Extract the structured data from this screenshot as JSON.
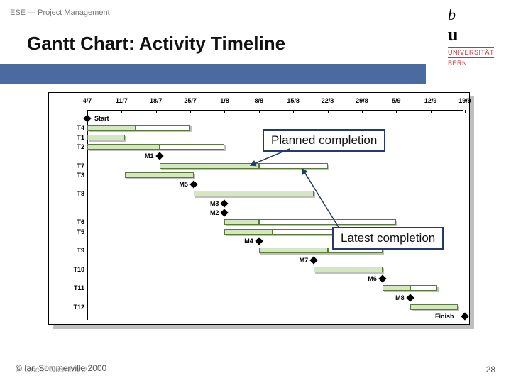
{
  "meta": {
    "breadcrumb": "ESE — Project Management",
    "title": "Gantt Chart: Activity Timeline",
    "uni_top": "b",
    "uni_mid": "u",
    "uni_line1": "UNIVERSITÄT",
    "uni_line2": "BERN",
    "footer_left": "© Ian Sommerville 2000",
    "footer_left_ghost": "© Oscar Nierstrasz",
    "page_number": "28"
  },
  "callouts": {
    "planned": "Planned completion",
    "latest": "Latest completion"
  },
  "chart_data": {
    "type": "bar",
    "title": "Gantt Chart: Activity Timeline",
    "xlabel": "",
    "ylabel": "",
    "x_dates": [
      "4/7",
      "11/7",
      "18/7",
      "25/7",
      "1/8",
      "8/8",
      "15/8",
      "22/8",
      "29/8",
      "5/9",
      "12/9",
      "19/9"
    ],
    "start_label": "Start",
    "finish_label": "Finish",
    "rows": [
      {
        "kind": "start",
        "label": "Start",
        "x": 0
      },
      {
        "kind": "task",
        "label": "T4",
        "plan": [
          0,
          1.4
        ],
        "slack": [
          1.4,
          3.0
        ]
      },
      {
        "kind": "task",
        "label": "T1",
        "plan": [
          0,
          1.1
        ]
      },
      {
        "kind": "task",
        "label": "T2",
        "plan": [
          0,
          2.1
        ],
        "slack": [
          2.1,
          4.0
        ]
      },
      {
        "kind": "milestone",
        "label": "M1",
        "x": 2.1
      },
      {
        "kind": "task",
        "label": "T7",
        "plan": [
          2.1,
          5.0
        ],
        "slack": [
          5.0,
          7.0
        ]
      },
      {
        "kind": "task",
        "label": "T3",
        "plan": [
          1.1,
          3.1
        ]
      },
      {
        "kind": "milestone",
        "label": "M5",
        "x": 3.1
      },
      {
        "kind": "task",
        "label": "T8",
        "plan": [
          3.1,
          6.6
        ]
      },
      {
        "kind": "milestone",
        "label": "M3",
        "x": 4.0
      },
      {
        "kind": "milestone",
        "label": "M2",
        "x": 4.0
      },
      {
        "kind": "task",
        "label": "T6",
        "plan": [
          4.0,
          5.0
        ],
        "slack": [
          5.0,
          9.0
        ]
      },
      {
        "kind": "task",
        "label": "T5",
        "plan": [
          4.0,
          5.4
        ],
        "slack": [
          5.4,
          8.6
        ]
      },
      {
        "kind": "milestone",
        "label": "M4",
        "x": 5.0
      },
      {
        "kind": "task",
        "label": "T9",
        "plan": [
          5.0,
          7.0
        ],
        "slack": [
          7.0,
          8.6
        ]
      },
      {
        "kind": "milestone",
        "label": "M7",
        "x": 6.6
      },
      {
        "kind": "task",
        "label": "T10",
        "plan": [
          6.6,
          8.6
        ]
      },
      {
        "kind": "milestone",
        "label": "M6",
        "x": 8.6
      },
      {
        "kind": "task",
        "label": "T11",
        "plan": [
          8.6,
          9.4
        ],
        "slack": [
          9.4,
          10.2
        ]
      },
      {
        "kind": "milestone",
        "label": "M8",
        "x": 9.4
      },
      {
        "kind": "task",
        "label": "T12",
        "plan": [
          9.4,
          10.8
        ]
      },
      {
        "kind": "finish",
        "label": "Finish",
        "x": 11
      }
    ]
  }
}
